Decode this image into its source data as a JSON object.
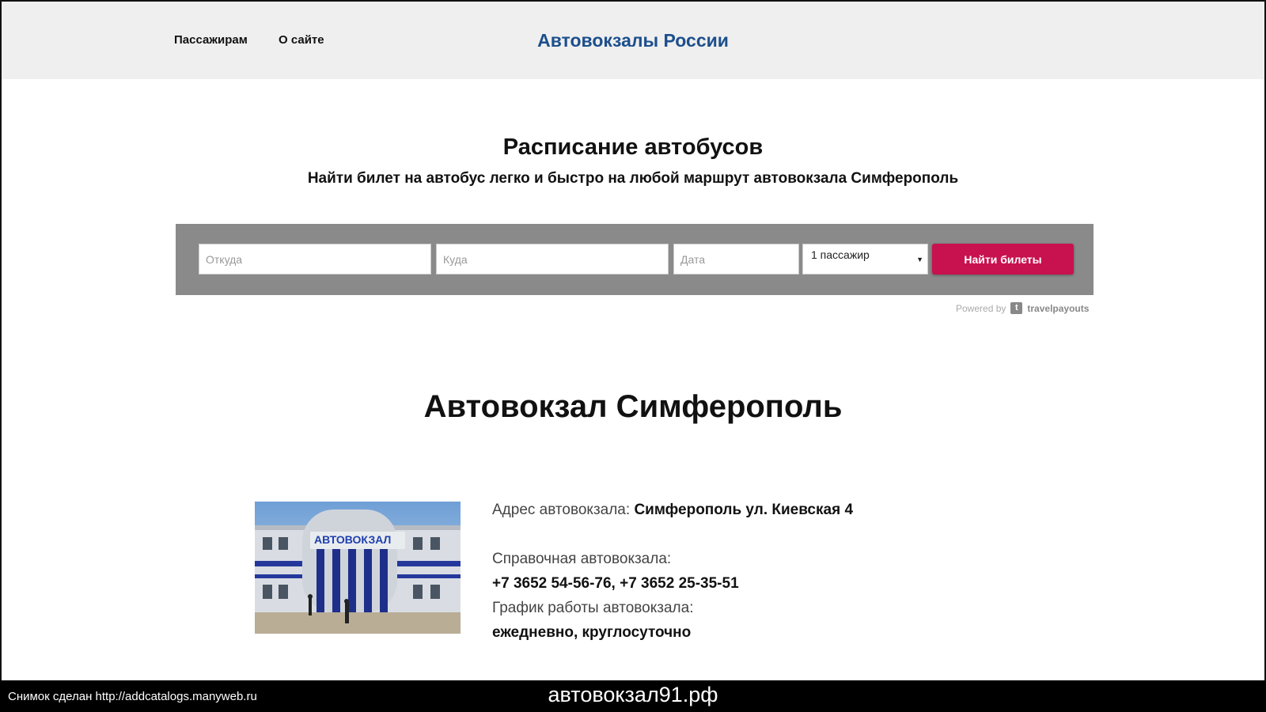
{
  "header": {
    "nav": [
      "Пассажирам",
      "О сайте"
    ],
    "site_title": "Автовокзалы России"
  },
  "hero": {
    "title": "Расписание автобусов",
    "subtitle": "Найти билет на автобус легко и быстро на любой маршрут автовокзала Симферополь"
  },
  "search": {
    "from_placeholder": "Откуда",
    "to_placeholder": "Куда",
    "date_placeholder": "Дата",
    "passengers_value": "1 пассажир",
    "submit_label": "Найти билеты",
    "powered_label": "Powered by",
    "powered_brand": "travelpayouts",
    "button_color": "#c8114f"
  },
  "station": {
    "title": "Автовокзал Симферополь",
    "photo_sign": "АВТОВОКЗАЛ",
    "address_label": "Адрес автовокзала:",
    "address_value": "Симферополь ул. Киевская 4",
    "phone_label": "Справочная автовокзала:",
    "phone_value": "+7 3652 54-56-76, +7 3652 25-35-51",
    "hours_label": "График работы автовокзала:",
    "hours_value": "ежедневно, круглосуточно"
  },
  "footer": {
    "caption": "Снимок сделан http://addcatalogs.manyweb.ru",
    "domain": "автовокзал91.рф"
  }
}
